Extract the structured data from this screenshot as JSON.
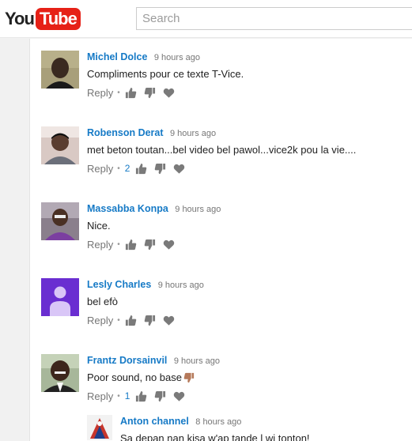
{
  "header": {
    "logo_you": "You",
    "logo_tube": "Tube",
    "search_placeholder": "Search"
  },
  "comments": [
    {
      "author": "Michel Dolce",
      "time": "9 hours ago",
      "text": "Compliments pour ce texte T-Vice.",
      "reply_label": "Reply",
      "likes": ""
    },
    {
      "author": "Robenson Derat",
      "time": "9 hours ago",
      "text": "met beton toutan...bel video bel pawol...vice2k pou la vie....",
      "reply_label": "Reply",
      "likes": "2"
    },
    {
      "author": "Massabba Konpa",
      "time": "9 hours ago",
      "text": "Nice.",
      "reply_label": "Reply",
      "likes": ""
    },
    {
      "author": "Lesly Charles",
      "time": "9 hours ago",
      "text": "bel efò",
      "reply_label": "Reply",
      "likes": ""
    },
    {
      "author": "Frantz Dorsainvil",
      "time": "9 hours ago",
      "text": "Poor sound, no base",
      "reply_label": "Reply",
      "likes": "1"
    }
  ],
  "reply": {
    "author": "Anton channel",
    "time": "8 hours ago",
    "text": "Sa depan nan kisa w'ap tande l wi tonton!"
  },
  "icons": {
    "like": "thumbs-up-icon",
    "dislike": "thumbs-down-icon",
    "heart": "heart-icon",
    "emoji": "thumbs-down-emoji"
  },
  "colors": {
    "author": "#167ac6",
    "brand_red": "#e62117",
    "meta_gray": "#767676",
    "icon_gray": "#7a7a7a"
  }
}
